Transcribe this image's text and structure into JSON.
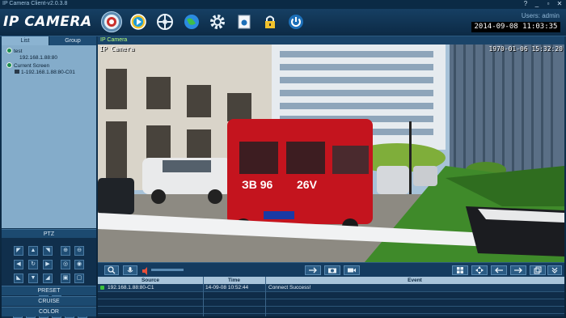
{
  "window": {
    "title": "IP Camera Client-v2.0.3.8",
    "controls": [
      "?",
      "_",
      "▫",
      "✕"
    ]
  },
  "header": {
    "logo": "IP CAMERA",
    "users": "Users: admin",
    "datetime": "2014-09-08 11:03:35",
    "toolbar_icons": [
      "live-view-icon",
      "playback-icon",
      "ptz-wheel-icon",
      "network-globe-icon",
      "settings-gear-icon",
      "snapshot-icon",
      "lock-icon",
      "power-icon"
    ]
  },
  "sidebar": {
    "tabs": [
      {
        "label": "List"
      },
      {
        "label": "Group"
      }
    ],
    "tree": {
      "group_name": "test",
      "group_device": "192.168.1.88:80",
      "screen_label": "Current Screen",
      "screen_device": "1-192.168.1.88:80-C01"
    },
    "ptz_label": "PTZ",
    "buttons": [
      "PRESET",
      "CRUISE",
      "COLOR"
    ]
  },
  "video": {
    "panel_title": "IP Camera",
    "osd_name": "IP Camera",
    "osd_time": "1970-01-06 15:32:20"
  },
  "log": {
    "columns": [
      "Source",
      "Time",
      "Event"
    ],
    "rows": [
      {
        "source": "192.168.1.88:80-C1",
        "time": "14-09-08 10:52:44",
        "event": "Connect Success!"
      }
    ]
  },
  "colors": {
    "accent_green": "#b8ff7a",
    "panel_blue": "#84acca",
    "dark_bg": "#0d2a44"
  }
}
